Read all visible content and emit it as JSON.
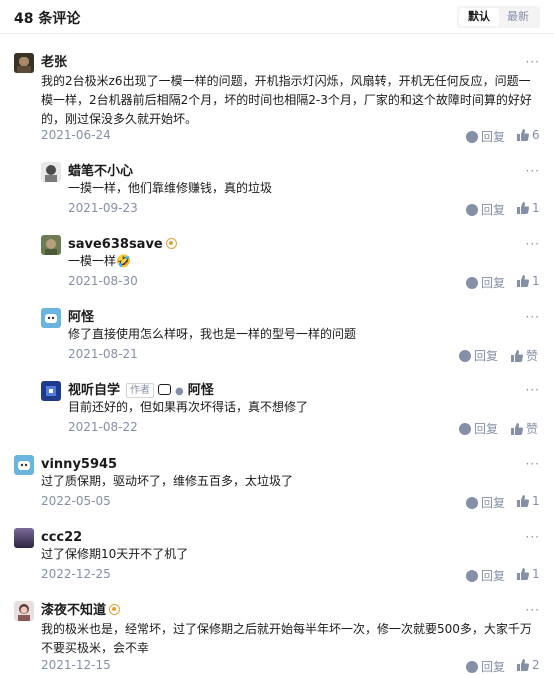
{
  "header": {
    "count_label": "48 条评论",
    "sort_default": "默认",
    "sort_latest": "最新"
  },
  "more_label": "···",
  "reply_label": "回复",
  "like_label": "赞",
  "comments": [
    {
      "name": "老张",
      "content_lines": [
        "我的2台极米z6出现了一模一样的问题，开机指示灯闪烁，风扇转，开机无任何反应，问题一",
        "模一样，2台机器前后相隔2个月，坏的时间也相隔2-3个月，厂家的和这个故障时间算的好好",
        "的，刚过保没多久就开始坏。"
      ],
      "date": "2021-06-24",
      "likes": "6"
    },
    {
      "name": "蜡笔不小心",
      "content": "一摸一样，他们靠维修赚钱，真的垃圾",
      "date": "2021-09-23",
      "likes": "1"
    },
    {
      "name": "save638save",
      "content": "一模一样🤣",
      "date": "2021-08-30",
      "likes": "1"
    },
    {
      "name": "阿怪",
      "content": "修了直接使用怎么样呀，我也是一样的型号一样的问题",
      "date": "2021-08-21",
      "likes": "赞"
    },
    {
      "name": "视听自学",
      "author_tag": "作者",
      "reply_to": "阿怪",
      "content": "目前还好的，但如果再次坏得话，真不想修了",
      "date": "2021-08-22",
      "likes": "赞"
    },
    {
      "name": "vinny5945",
      "content": "过了质保期，驱动坏了，维修五百多，太垃圾了",
      "date": "2022-05-05",
      "likes": "1"
    },
    {
      "name": "ccc22",
      "content": "过了保修期10天开不了机了",
      "date": "2022-12-25",
      "likes": "1"
    },
    {
      "name": "漆夜不知道",
      "content_lines": [
        "我的极米也是，经常坏，过了保修期之后就开始每半年坏一次，修一次就要500多，大家千万",
        "不要买极米，会不幸"
      ],
      "date": "2021-12-15",
      "likes": "2"
    }
  ],
  "colors": {
    "meta": "#8590a6",
    "text": "#1a1a1a",
    "divider": "#ebebeb"
  }
}
